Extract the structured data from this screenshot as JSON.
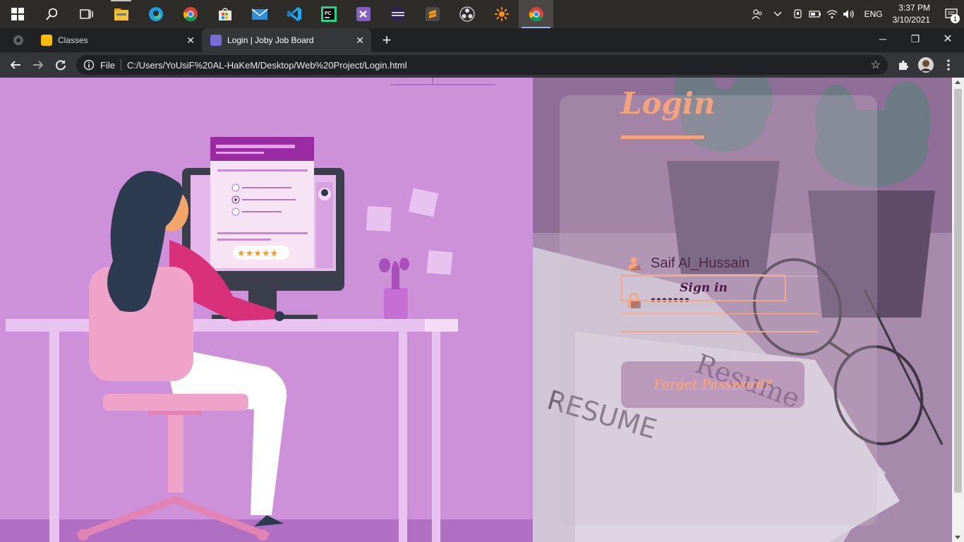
{
  "taskbar": {
    "apps": [
      {
        "name": "start",
        "open": false
      },
      {
        "name": "search",
        "open": false
      },
      {
        "name": "task-view",
        "open": false
      },
      {
        "name": "file-explorer",
        "open": true
      },
      {
        "name": "edge",
        "open": false
      },
      {
        "name": "chrome",
        "open": false
      },
      {
        "name": "store",
        "open": false
      },
      {
        "name": "mail",
        "open": false
      },
      {
        "name": "vscode",
        "open": false
      },
      {
        "name": "pycharm",
        "open": false
      },
      {
        "name": "visual-studio",
        "open": false
      },
      {
        "name": "eclipse",
        "open": false
      },
      {
        "name": "sublime",
        "open": false
      },
      {
        "name": "obs",
        "open": false
      },
      {
        "name": "sun-app",
        "open": false
      },
      {
        "name": "chrome-active",
        "open": true
      }
    ],
    "tray": {
      "language": "ENG",
      "time": "3:37 PM",
      "date": "3/10/2021",
      "notification_count": "1"
    }
  },
  "browser": {
    "tabs": [
      {
        "title": "Classes",
        "active": false
      },
      {
        "title": "Login | Joby Job Board",
        "active": true
      }
    ],
    "address": {
      "scheme_label": "File",
      "url": "C:/Users/YoUsiF%20AL-HaKeM/Desktop/Web%20Project/Login.html"
    }
  },
  "login": {
    "title": "Login",
    "username_value": "Saif Al_Hussain",
    "password_mask": "•••••••",
    "signin_label": "Sign in",
    "forget_label": "Forget Password?"
  },
  "background_text": {
    "resume_1": "RESUME",
    "resume_2": "Resume"
  },
  "colors": {
    "accent": "#f4a27c",
    "illustration_bg": "#cd91d9",
    "button_text": "#4a1b47"
  }
}
